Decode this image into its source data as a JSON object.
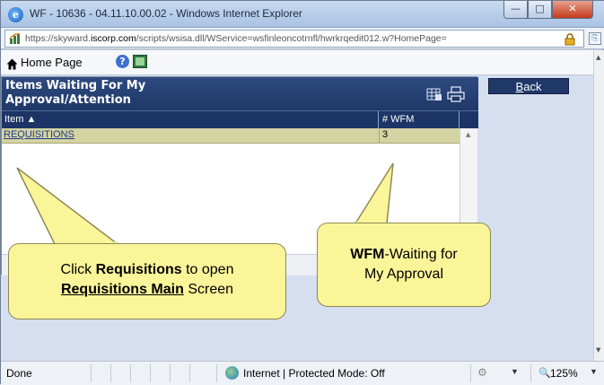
{
  "window": {
    "title": "WF - 10636 - 04.11.10.00.02 - Windows Internet Explorer",
    "min_glyph": "—",
    "max_glyph": "□",
    "close_glyph": "✕"
  },
  "address": {
    "url_prefix": "https://skyward.",
    "url_domain": "iscorp.com",
    "url_rest": "/scripts/wsisa.dll/WService=wsfinleoncotrnfl/hwrkrqedit012.w?HomePage="
  },
  "nav": {
    "home_label": "Home Page"
  },
  "panel": {
    "title": "Items Waiting For My Approval/Attention",
    "columns": {
      "item": "Item ▲",
      "wfm": "# WFM"
    },
    "rows": [
      {
        "item": "REQUISITIONS",
        "wfm": "3"
      }
    ]
  },
  "back_button": {
    "label_underlined": "B",
    "label_rest": "ack"
  },
  "callouts": {
    "requisitions": {
      "line1_pre": "Click ",
      "line1_bold": "Requisitions",
      "line1_post": " to open",
      "line2_underlined": "Requisitions Main",
      "line2_post": " Screen"
    },
    "wfm": {
      "line1_bold": "WFM",
      "line1_post": "-Waiting for",
      "line2": "My Approval"
    }
  },
  "status": {
    "left": "Done",
    "zone": "Internet | Protected Mode: Off",
    "zoom": "125%"
  },
  "colors": {
    "header_blue": "#1f3868",
    "row_highlight": "#d4d3a2",
    "callout_yellow": "#fbf59a"
  }
}
